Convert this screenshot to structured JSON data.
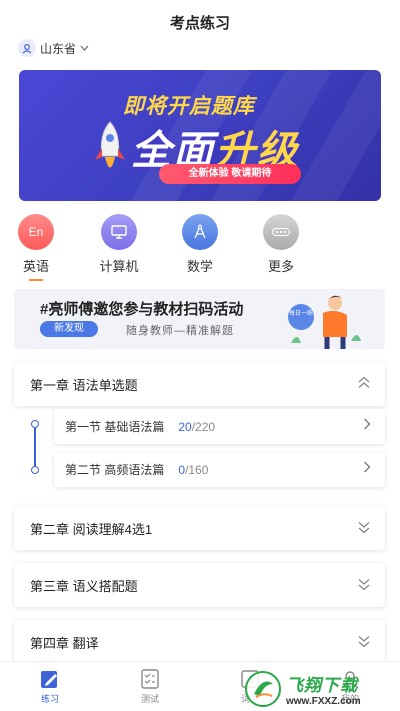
{
  "header": {
    "title": "考点练习"
  },
  "region": {
    "label": "山东省"
  },
  "banner": {
    "line1": "即将开启题库",
    "line2_a": "全面",
    "line2_b": "升级",
    "pill": "全新体验 敬请期待"
  },
  "categories": [
    {
      "label": "英语",
      "icon_text": "En",
      "color": "#ff6b6b",
      "icon": "en-icon"
    },
    {
      "label": "计算机",
      "icon_text": "",
      "color": "#8e83f0",
      "icon": "monitor-icon"
    },
    {
      "label": "数学",
      "icon_text": "",
      "color": "#5a86e8",
      "icon": "compass-icon"
    },
    {
      "label": "更多",
      "icon_text": "",
      "color": "#bfbfbf",
      "icon": "more-icon"
    }
  ],
  "promo": {
    "title": "#亮师傅邀您参与教材扫码活动",
    "badge": "新发现",
    "subtitle": "随身教师—精准解题",
    "bubble": "每日一练"
  },
  "chapters": [
    {
      "label": "第一章 语法单选题",
      "state": "expanded"
    },
    {
      "label": "第二章 阅读理解4选1",
      "state": "collapsed"
    },
    {
      "label": "第三章 语义搭配题",
      "state": "collapsed"
    },
    {
      "label": "第四章 翻译",
      "state": "collapsed"
    }
  ],
  "sections": [
    {
      "label": "第一节 基础语法篇",
      "done": "20",
      "total": "/220"
    },
    {
      "label": "第二节 高频语法篇",
      "done": "0",
      "total": "/160"
    }
  ],
  "tabs": [
    {
      "label": "练习",
      "active": true
    },
    {
      "label": "测试",
      "active": false
    },
    {
      "label": "词汇",
      "active": false
    },
    {
      "label": "我的",
      "active": false
    }
  ],
  "watermark": {
    "brand": "飞翔下载",
    "url": "www.FXXZ.com"
  },
  "colors": {
    "accent": "#3d64d6",
    "banner": "#4a47d6",
    "highlight": "#ffd84a"
  }
}
